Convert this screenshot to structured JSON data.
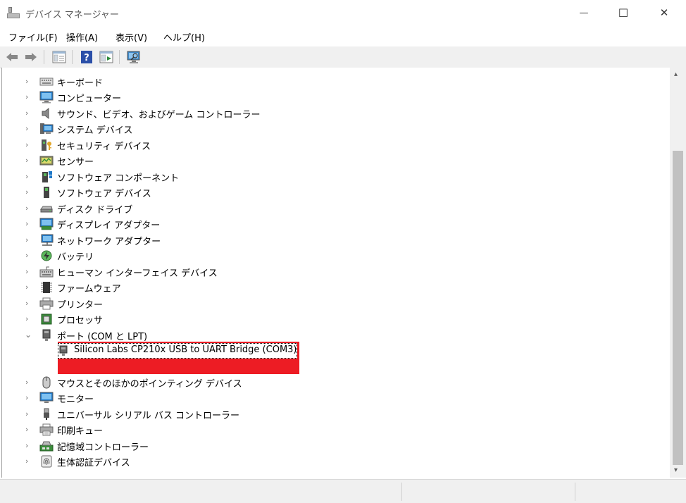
{
  "window": {
    "title": "デバイス マネージャー",
    "controls": {
      "minimize": "—",
      "maximize": "☐",
      "close": "✕"
    }
  },
  "menu": [
    "ファイル(F)",
    "操作(A)",
    "表示(V)",
    "ヘルプ(H)"
  ],
  "toolbar": [
    "back-arrow-icon",
    "forward-arrow-icon",
    "properties-icon",
    "help-icon",
    "update-driver-icon",
    "scan-hardware-icon"
  ],
  "tree": {
    "items": [
      {
        "label": "キーボード",
        "icon": "keyboard-icon",
        "expanded": false
      },
      {
        "label": "コンピューター",
        "icon": "computer-icon",
        "expanded": false
      },
      {
        "label": "サウンド、ビデオ、およびゲーム コントローラー",
        "icon": "speaker-icon",
        "expanded": false
      },
      {
        "label": "システム デバイス",
        "icon": "system-devices-icon",
        "expanded": false
      },
      {
        "label": "セキュリティ デバイス",
        "icon": "security-key-icon",
        "expanded": false
      },
      {
        "label": "センサー",
        "icon": "sensor-icon",
        "expanded": false
      },
      {
        "label": "ソフトウェア コンポーネント",
        "icon": "software-component-icon",
        "expanded": false
      },
      {
        "label": "ソフトウェア デバイス",
        "icon": "software-device-icon",
        "expanded": false
      },
      {
        "label": "ディスク ドライブ",
        "icon": "disk-drive-icon",
        "expanded": false
      },
      {
        "label": "ディスプレイ アダプター",
        "icon": "display-adapter-icon",
        "expanded": false
      },
      {
        "label": "ネットワーク アダプター",
        "icon": "network-adapter-icon",
        "expanded": false
      },
      {
        "label": "バッテリ",
        "icon": "battery-icon",
        "expanded": false
      },
      {
        "label": "ヒューマン インターフェイス デバイス",
        "icon": "hid-icon",
        "expanded": false
      },
      {
        "label": "ファームウェア",
        "icon": "firmware-chip-icon",
        "expanded": false
      },
      {
        "label": "プリンター",
        "icon": "printer-icon",
        "expanded": false
      },
      {
        "label": "プロセッサ",
        "icon": "processor-icon",
        "expanded": false
      },
      {
        "label": "ポート (COM と LPT)",
        "icon": "port-icon",
        "expanded": true,
        "children": [
          {
            "label": "Silicon Labs CP210x USB to UART Bridge (COM3)",
            "icon": "port-connector-icon",
            "selected": true
          }
        ]
      },
      {
        "label": "マウスとそのほかのポインティング デバイス",
        "icon": "mouse-icon",
        "expanded": false
      },
      {
        "label": "モニター",
        "icon": "monitor-icon",
        "expanded": false
      },
      {
        "label": "ユニバーサル シリアル バス コントローラー",
        "icon": "usb-icon",
        "expanded": false
      },
      {
        "label": "印刷キュー",
        "icon": "print-queue-icon",
        "expanded": false
      },
      {
        "label": "記憶域コントローラー",
        "icon": "storage-controller-icon",
        "expanded": false
      },
      {
        "label": "生体認証デバイス",
        "icon": "fingerprint-icon",
        "expanded": false
      }
    ]
  },
  "colors": {
    "highlight": "#ed1c24",
    "accent_blue": "#1e78c8"
  }
}
